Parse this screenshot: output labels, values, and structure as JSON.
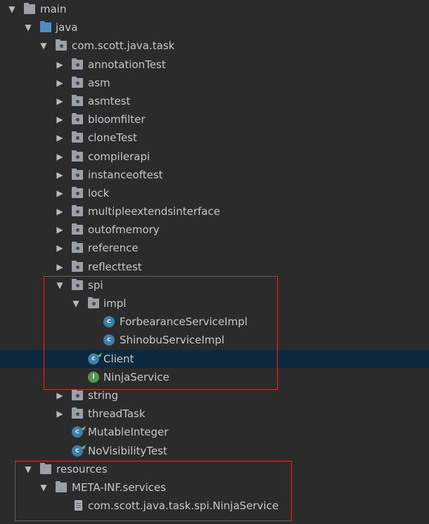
{
  "tree": {
    "main": "main",
    "java": "java",
    "package": "com.scott.java.task",
    "packages": {
      "annotationTest": "annotationTest",
      "asm": "asm",
      "asmtest": "asmtest",
      "bloomfilter": "bloomfilter",
      "cloneTest": "cloneTest",
      "compilerapi": "compilerapi",
      "instanceoftest": "instanceoftest",
      "lock": "lock",
      "multipleextendsinterface": "multipleextendsinterface",
      "outofmemory": "outofmemory",
      "reference": "reference",
      "reflecttest": "reflecttest",
      "spi": "spi",
      "impl": "impl",
      "string": "string",
      "threadTask": "threadTask"
    },
    "classes": {
      "forbearance": "ForbearanceServiceImpl",
      "shinobu": "ShinobuServiceImpl",
      "client": "Client",
      "ninja": "NinjaService",
      "mutable": "MutableInteger",
      "novisibility": "NoVisibilityTest"
    },
    "resources": "resources",
    "metainf": "META-INF.services",
    "service_file": "com.scott.java.task.spi.NinjaService",
    "class_glyph": "c",
    "interface_glyph": "I",
    "expanded_arrow": "▼",
    "collapsed_arrow": "▶"
  },
  "colors": {
    "background": "#2b2b2b",
    "selection": "#0d293e",
    "highlight_box": "#c23b3b",
    "text": "#c6c8cb"
  },
  "icons": [
    "folder-icon",
    "source-folder-icon",
    "package-icon",
    "class-icon",
    "interface-icon",
    "resources-folder-icon",
    "file-icon"
  ]
}
